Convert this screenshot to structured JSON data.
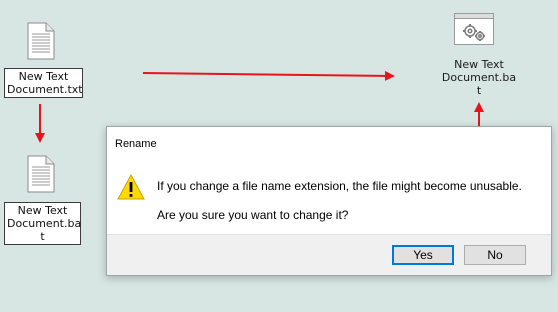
{
  "desktop": {
    "txt_file": {
      "name": "New Text Document.txt",
      "icon": "text-document-icon"
    },
    "bat_file": {
      "name_line1": "New Text",
      "name_line2": "Document.ba",
      "name_line3": "t",
      "icon": "text-document-icon"
    },
    "renamed_bat": {
      "name_line1": "New Text",
      "name_line2": "Document.ba",
      "name_line3": "t",
      "icon": "batch-file-gears-icon"
    }
  },
  "dialog": {
    "title": "Rename",
    "message": "If you change a file name extension, the file might become unusable.",
    "question": "Are you sure you want to change it?",
    "warning_icon": "warning-triangle-icon",
    "buttons": {
      "yes": "Yes",
      "no": "No"
    }
  },
  "annotations": {
    "arrow_color": "#e8141c"
  }
}
